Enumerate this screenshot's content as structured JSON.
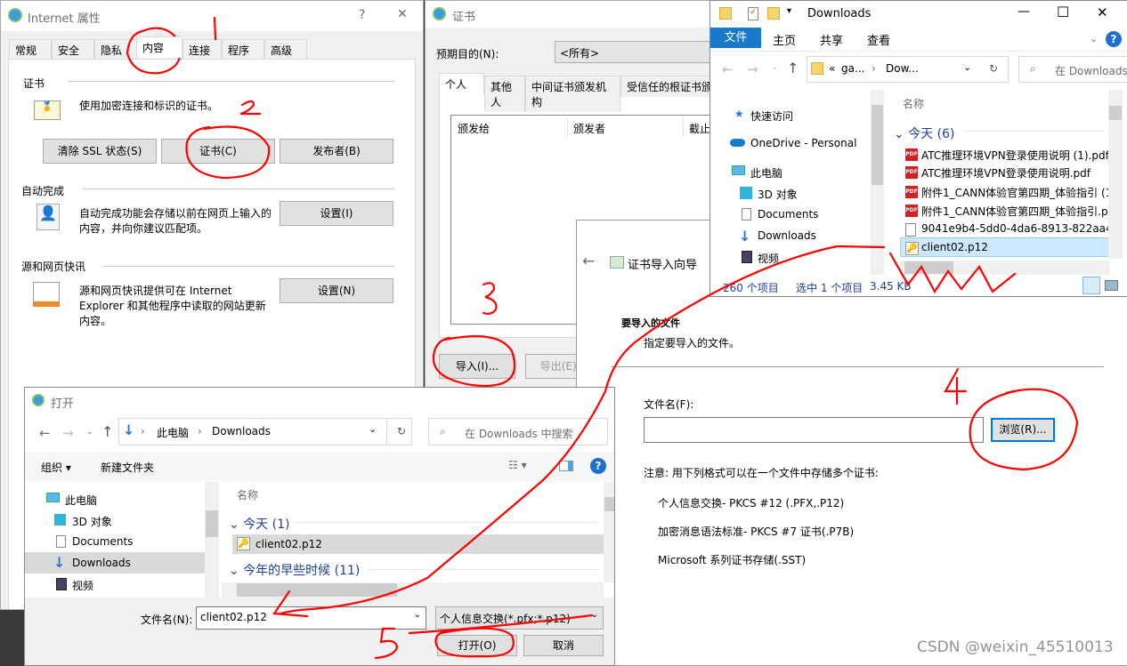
{
  "internet_options": {
    "title": "Internet 属性",
    "help": "?",
    "close": "✕",
    "tabs": [
      "常规",
      "安全",
      "隐私",
      "内容",
      "连接",
      "程序",
      "高级"
    ],
    "selected_tab": "内容",
    "certificates": {
      "heading": "证书",
      "description": "使用加密连接和标识的证书。",
      "clear_ssl": "清除 SSL 状态(S)",
      "certificates_btn": "证书(C)",
      "publishers_btn": "发布者(B)"
    },
    "autocomplete": {
      "heading": "自动完成",
      "description_1": "自动完成功能会存储以前在网页上输入的",
      "description_2": "内容，并向你建议匹配项。",
      "settings_btn": "设置(I)"
    },
    "feeds": {
      "heading": "源和网页快讯",
      "description_1": "源和网页快讯提供可在 Internet",
      "description_2": "Explorer 和其他程序中读取的网站更新",
      "description_3": "内容。",
      "settings_btn": "设置(N)"
    }
  },
  "cert_dialog": {
    "title": "证书",
    "purpose_label": "预期目的(N):",
    "purpose_value": "<所有>",
    "tabs": [
      "个人",
      "其他人",
      "中间证书颁发机构",
      "受信任的根证书颁"
    ],
    "columns": [
      "颁发给",
      "颁发者",
      "截止"
    ],
    "import_btn": "导入(I)...",
    "export_btn": "导出(E)..."
  },
  "import_wizard": {
    "back": "←",
    "title": "证书导入向导",
    "section_title": "要导入的文件",
    "section_desc": "指定要导入的文件。",
    "filename_label": "文件名(F):",
    "filename_value": "",
    "browse_btn": "浏览(R)...",
    "note": "注意: 用下列格式可以在一个文件中存储多个证书:",
    "formats": [
      "个人信息交换- PKCS #12 (.PFX,.P12)",
      "加密消息语法标准- PKCS #7 证书(.P7B)",
      "Microsoft 系列证书存储(.SST)"
    ]
  },
  "explorer": {
    "title": "Downloads",
    "controls": {
      "minimize": "—",
      "maximize": "☐",
      "close": "✕"
    },
    "ribbon": {
      "file": "文件",
      "tabs": [
        "主页",
        "共享",
        "查看"
      ],
      "help": "?"
    },
    "accent": "#1979ca",
    "address": {
      "overflow": "«",
      "crumbs": [
        "ga...",
        "Dow..."
      ],
      "sep": "›"
    },
    "search_placeholder": "在 Downloads",
    "nav": [
      "快速访问",
      "OneDrive - Personal",
      "此电脑",
      "3D 对象",
      "Documents",
      "Downloads",
      "视频"
    ],
    "column": "名称",
    "group": "今天 (6)",
    "files": [
      {
        "name": "ATC推理环境VPN登录使用说明 (1).pdf",
        "icon": "pdf"
      },
      {
        "name": "ATC推理环境VPN登录使用说明.pdf",
        "icon": "pdf"
      },
      {
        "name": "附件1_CANN体验官第四期_体验指引 (1",
        "icon": "pdf"
      },
      {
        "name": "附件1_CANN体验官第四期_体验指引.pd",
        "icon": "pdf"
      },
      {
        "name": "9041e9b4-5dd0-4da6-8913-822aa49",
        "icon": "file"
      },
      {
        "name": "client02.p12",
        "icon": "certificate",
        "selected": true
      }
    ],
    "status": {
      "count": "260 个项目",
      "selection": "选中 1 个项目",
      "size": "3.45 KB"
    }
  },
  "open_dialog": {
    "title": "打开",
    "breadcrumb": [
      "此电脑",
      "Downloads"
    ],
    "search_placeholder": "在 Downloads 中搜索",
    "organize": "组织 ▾",
    "new_folder": "新建文件夹",
    "nav": [
      "此电脑",
      "3D 对象",
      "Documents",
      "Downloads",
      "视频"
    ],
    "selected_nav": "Downloads",
    "column": "名称",
    "groups": [
      {
        "label": "今天 (1)",
        "files": [
          "client02.p12"
        ]
      },
      {
        "label": "今年的早些时候 (11)",
        "files": []
      }
    ],
    "filename_label": "文件名(N):",
    "filename_value": "client02.p12",
    "filter": "个人信息交换(*.pfx;*.p12)",
    "open_btn": "打开(O)",
    "cancel_btn": "取消"
  },
  "annotations": [
    "1",
    "2",
    "3",
    "4",
    "5"
  ],
  "annotation_color": "#ff0000",
  "watermark": "CSDN @weixin_45510013"
}
